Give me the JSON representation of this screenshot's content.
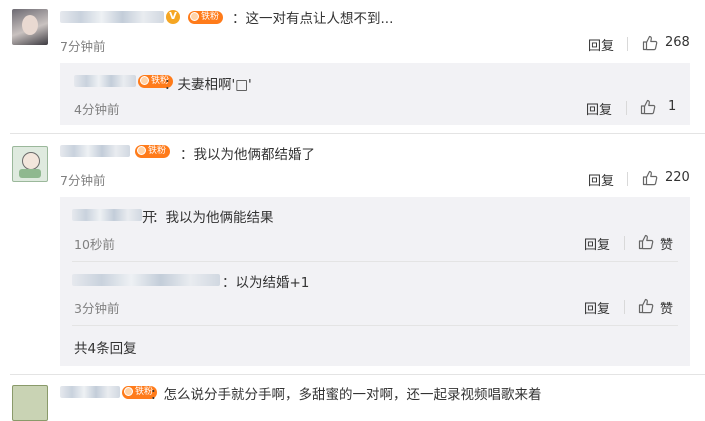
{
  "comments": [
    {
      "text": "：这一对有点让人想不到...",
      "time": "7分钟前",
      "reply": "回复",
      "likes": "268",
      "badge": "铁粉",
      "vip": "V"
    },
    {
      "text": "：我以为他俩都结婚了",
      "time": "7分钟前",
      "reply": "回复",
      "likes": "220",
      "badge": "铁粉"
    },
    {
      "text": "：怎么说分手就分手啊，多甜蜜的一对啊，还一起录视频唱歌来着",
      "badge": "铁粉"
    }
  ],
  "replies_1": [
    {
      "text": "：夫妻相啊'□'",
      "time": "4分钟前",
      "reply": "回复",
      "likes": "1",
      "badge": "铁粉"
    }
  ],
  "replies_2": [
    {
      "name_suffix": "开",
      "text": "：我以为他俩能结果",
      "time": "10秒前",
      "reply": "回复",
      "like_label": "赞"
    },
    {
      "text": "：以为结婚+1",
      "time": "3分钟前",
      "reply": "回复",
      "like_label": "赞"
    }
  ],
  "more_replies": "共4条回复",
  "colors": {
    "badge": "#ff7b1a",
    "vip": "#f5a623",
    "reply_bg": "#f2f2f5"
  }
}
